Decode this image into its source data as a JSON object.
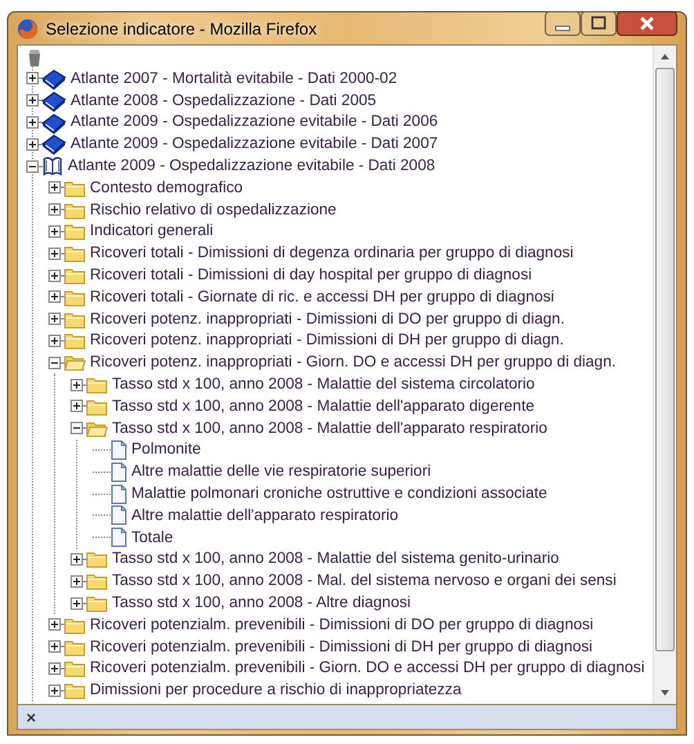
{
  "window": {
    "title": "Selezione indicatore - Mozilla Firefox"
  },
  "tree": [
    {
      "kind": "book",
      "label": "Atlante 2007 - Mortalità evitabile - Dati 2000-02",
      "expanded": false
    },
    {
      "kind": "book",
      "label": "Atlante 2008 - Ospedalizzazione - Dati 2005",
      "expanded": false
    },
    {
      "kind": "book",
      "label": "Atlante 2009 - Ospedalizzazione evitabile - Dati 2006",
      "expanded": false
    },
    {
      "kind": "book",
      "label": "Atlante 2009 - Ospedalizzazione evitabile - Dati 2007",
      "expanded": false
    },
    {
      "kind": "book",
      "label": "Atlante 2009 - Ospedalizzazione evitabile - Dati 2008",
      "expanded": true,
      "children": [
        {
          "kind": "folder",
          "label": "Contesto demografico",
          "expanded": false
        },
        {
          "kind": "folder",
          "label": "Rischio relativo di ospedalizzazione",
          "expanded": false
        },
        {
          "kind": "folder",
          "label": "Indicatori generali",
          "expanded": false
        },
        {
          "kind": "folder",
          "label": "Ricoveri totali - Dimissioni di degenza ordinaria per gruppo di diagnosi",
          "expanded": false
        },
        {
          "kind": "folder",
          "label": "Ricoveri totali - Dimissioni di day hospital per gruppo di diagnosi",
          "expanded": false
        },
        {
          "kind": "folder",
          "label": "Ricoveri totali - Giornate di ric. e accessi DH per gruppo di diagnosi",
          "expanded": false
        },
        {
          "kind": "folder",
          "label": "Ricoveri potenz. inappropriati - Dimissioni di DO per gruppo di diagn.",
          "expanded": false
        },
        {
          "kind": "folder",
          "label": "Ricoveri potenz. inappropriati - Dimissioni di DH per gruppo di diagn.",
          "expanded": false
        },
        {
          "kind": "folder",
          "label": "Ricoveri potenz. inappropriati - Giorn. DO e accessi DH per gruppo di diagn.",
          "expanded": true,
          "children": [
            {
              "kind": "folder",
              "label": "Tasso std x 100, anno 2008 - Malattie del sistema circolatorio",
              "expanded": false
            },
            {
              "kind": "folder",
              "label": "Tasso std x 100, anno 2008 - Malattie dell'apparato digerente",
              "expanded": false
            },
            {
              "kind": "folder",
              "label": "Tasso std x 100, anno 2008 - Malattie dell'apparato respiratorio",
              "expanded": true,
              "children": [
                {
                  "kind": "file",
                  "label": "Polmonite"
                },
                {
                  "kind": "file",
                  "label": "Altre malattie delle vie respiratorie superiori"
                },
                {
                  "kind": "file",
                  "label": "Malattie polmonari croniche ostruttive e condizioni associate"
                },
                {
                  "kind": "file",
                  "label": "Altre malattie dell'apparato respiratorio"
                },
                {
                  "kind": "file",
                  "label": "Totale"
                }
              ]
            },
            {
              "kind": "folder",
              "label": "Tasso std x 100, anno 2008 - Malattie del sistema genito-urinario",
              "expanded": false
            },
            {
              "kind": "folder",
              "label": "Tasso std x 100, anno 2008 - Mal. del sistema nervoso e organi dei sensi",
              "expanded": false
            },
            {
              "kind": "folder",
              "label": "Tasso std x 100, anno 2008 - Altre diagnosi",
              "expanded": false
            }
          ]
        },
        {
          "kind": "folder",
          "label": "Ricoveri potenzialm. prevenibili - Dimissioni di DO per gruppo di diagnosi",
          "expanded": false
        },
        {
          "kind": "folder",
          "label": "Ricoveri potenzialm. prevenibili - Dimissioni di DH per gruppo di diagnosi",
          "expanded": false
        },
        {
          "kind": "folder",
          "label": "Ricoveri potenzialm. prevenibili - Giorn. DO e accessi DH per gruppo di diagnosi",
          "expanded": false
        },
        {
          "kind": "folder",
          "label": "Dimissioni per procedure a rischio di inappropriatezza",
          "expanded": false
        }
      ]
    }
  ],
  "status_bar": {
    "close_label": "×"
  }
}
